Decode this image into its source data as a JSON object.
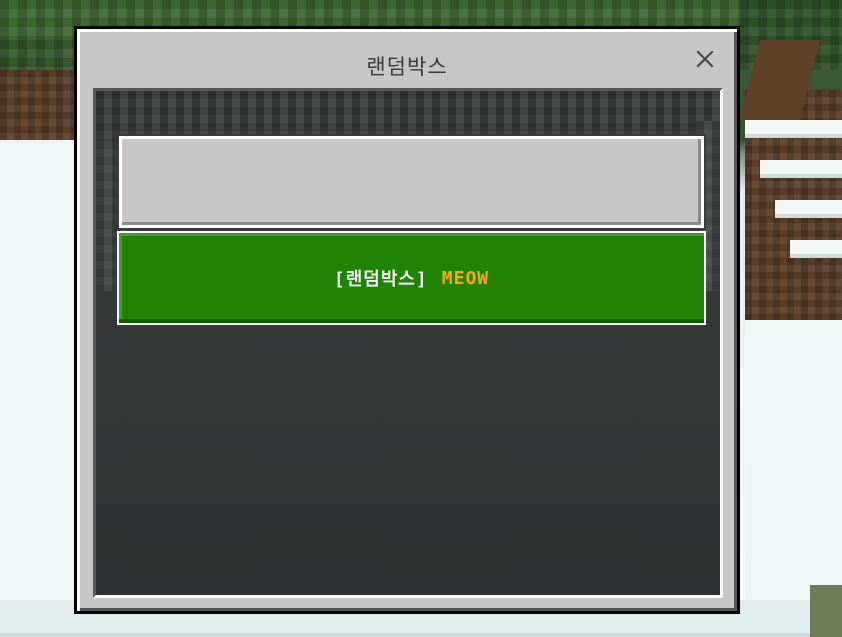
{
  "dialog": {
    "title": "랜덤박스",
    "close_icon": "close-icon"
  },
  "buttons": [
    {
      "id": "disabled-option",
      "label": "",
      "state": "disabled"
    },
    {
      "id": "randombox-meow",
      "tag": "[랜덤박스]",
      "name": "MEOW",
      "state": "primary"
    }
  ],
  "colors": {
    "dialog_bg": "#c6c6c6",
    "panel_bg": "#3a3d3d",
    "primary_button": "#1f8306",
    "name_accent": "#ffaa00",
    "disabled_button": "#c6c6c6"
  }
}
